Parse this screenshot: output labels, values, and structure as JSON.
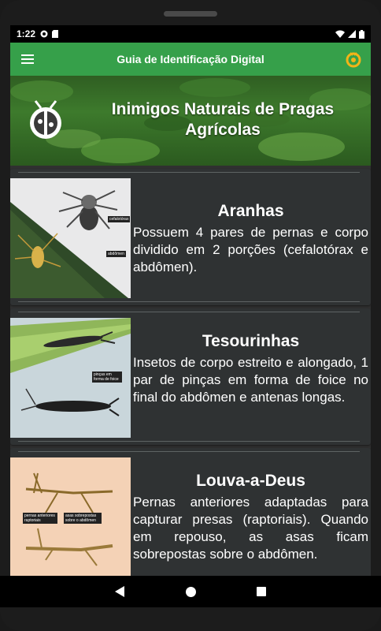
{
  "status_bar": {
    "time": "1:22"
  },
  "app_bar": {
    "title": "Guia de Identificação Digital"
  },
  "hero": {
    "title": "Inimigos Naturais de Pragas Agrícolas"
  },
  "cards": [
    {
      "title": "Aranhas",
      "description": "Possuem 4 pares de pernas e corpo dividido em 2 porções (cefalotórax e abdômen).",
      "labels": [
        "cefalotórax",
        "abdômen"
      ]
    },
    {
      "title": "Tesourinhas",
      "description": "Insetos de corpo estreito e alongado, 1 par de pinças em forma de foice no final do abdômen e antenas longas.",
      "labels": [
        "pinças em forma de foice"
      ]
    },
    {
      "title": "Louva-a-Deus",
      "description": "Pernas anteriores adaptadas para capturar presas (raptoriais). Quando em repouso, as asas ficam sobrepostas sobre o abdômen.",
      "labels": [
        "pernas anteriores raptoriais",
        "asas sobrepostas sobre o abdômen"
      ]
    }
  ],
  "nav": {
    "back": "back-icon",
    "home": "home-icon",
    "recents": "recents-icon"
  },
  "colors": {
    "appbar": "#36a04a",
    "card": "#2f3233",
    "screen_bg": "#303030"
  }
}
